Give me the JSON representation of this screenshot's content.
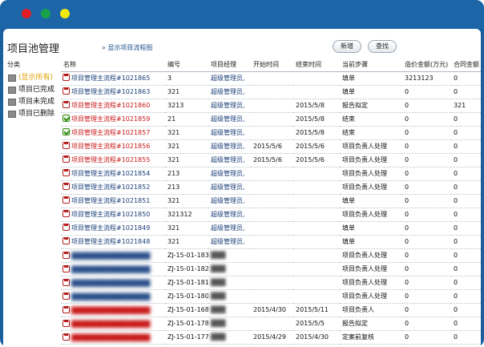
{
  "page": {
    "title": "项目池管理",
    "flow_link": "» 显示项目流程图",
    "new_button": "新增",
    "search_button": "查找"
  },
  "categories": {
    "header": "分类",
    "items": [
      {
        "label": "(显示所有)",
        "active": true
      },
      {
        "label": "项目已完成",
        "active": false
      },
      {
        "label": "项目未完成",
        "active": false
      },
      {
        "label": "项目已删除",
        "active": false
      }
    ]
  },
  "table": {
    "columns": [
      "名称",
      "编号",
      "项目经理",
      "开始时间",
      "结束时间",
      "当前步骤",
      "造价金额(万元)",
      "合同金额"
    ],
    "rows": [
      {
        "name": "项目管理主流程#1021865",
        "code": "3",
        "manager": "超级管理员,",
        "start": "",
        "end": "",
        "step": "填单",
        "cost": "3213123",
        "contract": "0",
        "icon": "doc",
        "red": false,
        "blurred": false
      },
      {
        "name": "项目管理主流程#1021863",
        "code": "321",
        "manager": "超级管理员,",
        "start": "",
        "end": "",
        "step": "填单",
        "cost": "0",
        "contract": "0",
        "icon": "doc",
        "red": false,
        "blurred": false
      },
      {
        "name": "项目管理主流程#1021860",
        "code": "3213",
        "manager": "超级管理员,",
        "start": "",
        "end": "2015/5/8",
        "step": "报告拟定",
        "cost": "0",
        "contract": "321",
        "icon": "doc",
        "red": true,
        "blurred": false
      },
      {
        "name": "项目管理主流程#1021859",
        "code": "21",
        "manager": "超级管理员,",
        "start": "",
        "end": "2015/5/8",
        "step": "结束",
        "cost": "0",
        "contract": "0",
        "icon": "check",
        "red": true,
        "blurred": false
      },
      {
        "name": "项目管理主流程#1021857",
        "code": "321",
        "manager": "超级管理员,",
        "start": "",
        "end": "2015/5/8",
        "step": "结束",
        "cost": "0",
        "contract": "0",
        "icon": "check",
        "red": true,
        "blurred": false
      },
      {
        "name": "项目管理主流程#1021856",
        "code": "321",
        "manager": "超级管理员,",
        "start": "2015/5/6",
        "end": "2015/5/6",
        "step": "项目负责人处理",
        "cost": "0",
        "contract": "0",
        "icon": "doc",
        "red": true,
        "blurred": false
      },
      {
        "name": "项目管理主流程#1021855",
        "code": "321",
        "manager": "超级管理员,",
        "start": "2015/5/6",
        "end": "2015/5/6",
        "step": "项目负责人处理",
        "cost": "0",
        "contract": "0",
        "icon": "doc",
        "red": true,
        "blurred": false
      },
      {
        "name": "项目管理主流程#1021854",
        "code": "213",
        "manager": "超级管理员,",
        "start": "",
        "end": "",
        "step": "项目负责人处理",
        "cost": "0",
        "contract": "0",
        "icon": "doc",
        "red": false,
        "blurred": false
      },
      {
        "name": "项目管理主流程#1021852",
        "code": "213",
        "manager": "超级管理员,",
        "start": "",
        "end": "",
        "step": "项目负责人处理",
        "cost": "0",
        "contract": "0",
        "icon": "doc",
        "red": false,
        "blurred": false
      },
      {
        "name": "项目管理主流程#1021851",
        "code": "321",
        "manager": "超级管理员,",
        "start": "",
        "end": "",
        "step": "填单",
        "cost": "0",
        "contract": "0",
        "icon": "doc",
        "red": false,
        "blurred": false
      },
      {
        "name": "项目管理主流程#1021850",
        "code": "321312",
        "manager": "超级管理员,",
        "start": "",
        "end": "",
        "step": "项目负责人处理",
        "cost": "0",
        "contract": "0",
        "icon": "doc",
        "red": false,
        "blurred": false
      },
      {
        "name": "项目管理主流程#1021849",
        "code": "321",
        "manager": "超级管理员,",
        "start": "",
        "end": "",
        "step": "填单",
        "cost": "0",
        "contract": "0",
        "icon": "doc",
        "red": false,
        "blurred": false
      },
      {
        "name": "项目管理主流程#1021848",
        "code": "321",
        "manager": "超级管理员,",
        "start": "",
        "end": "",
        "step": "填单",
        "cost": "0",
        "contract": "0",
        "icon": "doc",
        "red": false,
        "blurred": false
      },
      {
        "name": "████████████████",
        "code": "ZJ-15-01-183",
        "manager": "███",
        "start": "",
        "end": "",
        "step": "项目负责人处理",
        "cost": "0",
        "contract": "0",
        "icon": "doc",
        "red": false,
        "blurred": true
      },
      {
        "name": "████████████████",
        "code": "ZJ-15-01-182",
        "manager": "███",
        "start": "",
        "end": "",
        "step": "项目负责人处理",
        "cost": "0",
        "contract": "0",
        "icon": "doc",
        "red": false,
        "blurred": true
      },
      {
        "name": "████████████████",
        "code": "ZJ-15-01-181",
        "manager": "███",
        "start": "",
        "end": "",
        "step": "项目负责人处理",
        "cost": "0",
        "contract": "0",
        "icon": "doc",
        "red": false,
        "blurred": true
      },
      {
        "name": "████████████████",
        "code": "ZJ-15-01-180",
        "manager": "███",
        "start": "",
        "end": "",
        "step": "项目负责人处理",
        "cost": "0",
        "contract": "0",
        "icon": "doc",
        "red": false,
        "blurred": true
      },
      {
        "name": "████████████████",
        "code": "ZJ-15-01-168",
        "manager": "███",
        "start": "2015/4/30",
        "end": "2015/5/11",
        "step": "项目负责人",
        "cost": "0",
        "contract": "0",
        "icon": "doc",
        "red": true,
        "blurred": true
      },
      {
        "name": "████████████████",
        "code": "ZJ-15-01-178",
        "manager": "███",
        "start": "",
        "end": "2015/5/5",
        "step": "报告拟定",
        "cost": "0",
        "contract": "0",
        "icon": "doc",
        "red": true,
        "blurred": true
      },
      {
        "name": "████████████████",
        "code": "ZJ-15-01-177",
        "manager": "███",
        "start": "2015/4/29",
        "end": "2015/4/30",
        "step": "定案前复核",
        "cost": "0",
        "contract": "0",
        "icon": "doc",
        "red": true,
        "blurred": true
      }
    ]
  },
  "colors": {
    "frame": "#1c66a8",
    "link": "#1b3f7a",
    "overdue": "#c81818",
    "active_category": "#e0a000"
  },
  "icons": {
    "window_close": "red-dot-icon",
    "window_minimize": "green-dot-icon",
    "window_maximize": "yellow-dot-icon",
    "category": "folder-icon",
    "row_doc": "document-icon",
    "row_done": "checkbox-checked-icon"
  }
}
